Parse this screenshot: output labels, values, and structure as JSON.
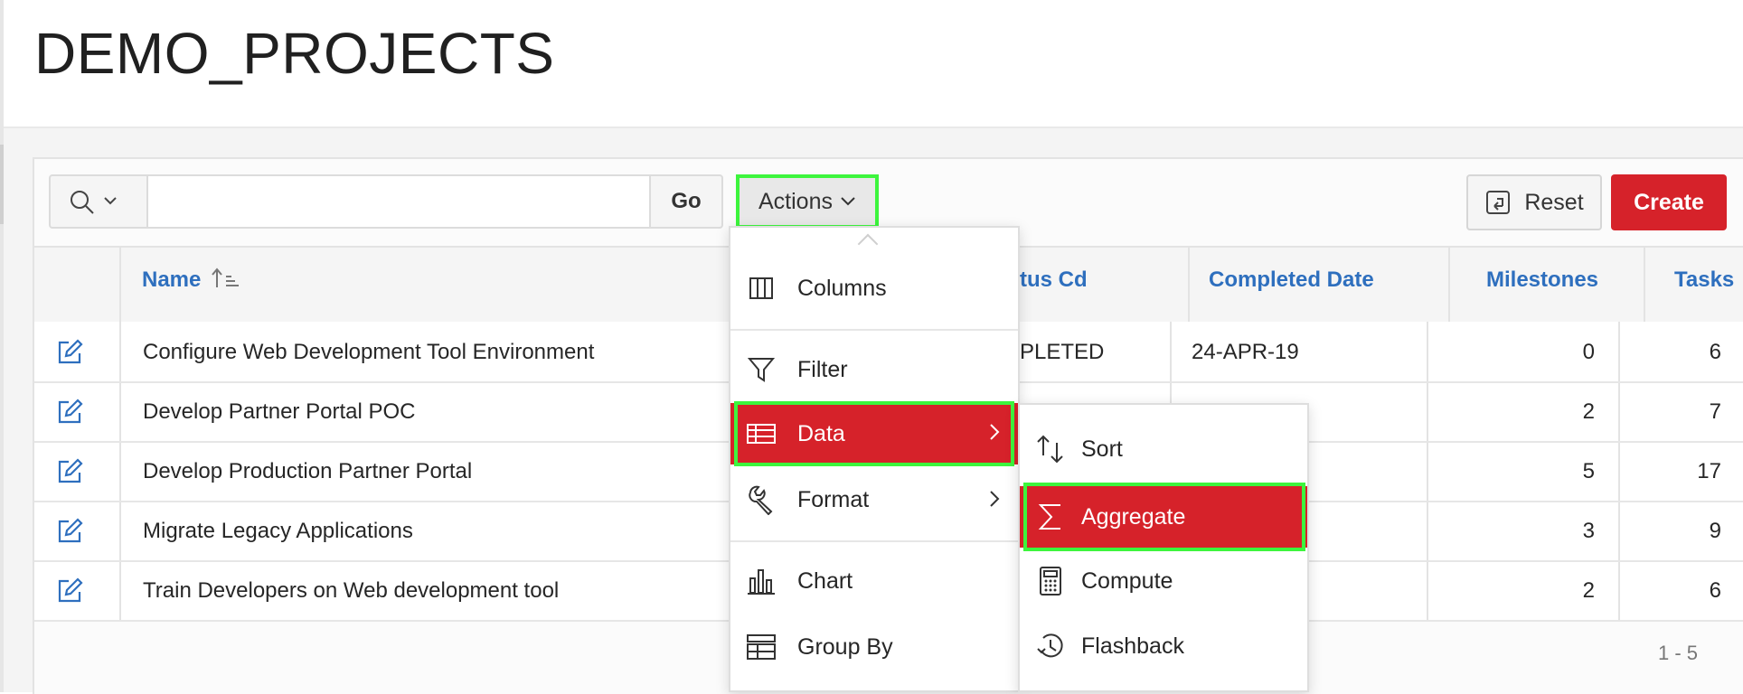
{
  "page": {
    "title": "DEMO_PROJECTS"
  },
  "toolbar": {
    "search_placeholder": "",
    "go_label": "Go",
    "actions_label": "Actions",
    "reset_label": "Reset",
    "create_label": "Create"
  },
  "table": {
    "columns": [
      {
        "label": "Name"
      },
      {
        "label": "tus Cd"
      },
      {
        "label": "Completed Date"
      },
      {
        "label": "Milestones"
      },
      {
        "label": "Tasks"
      }
    ],
    "rows": [
      {
        "name": "Configure Web Development Tool Environment",
        "status": "PLETED",
        "completed": "24-APR-19",
        "milestones": "0",
        "tasks": "6"
      },
      {
        "name": "Develop Partner Portal POC",
        "status": "",
        "completed": "",
        "milestones": "2",
        "tasks": "7"
      },
      {
        "name": "Develop Production Partner Portal",
        "status": "",
        "completed": "",
        "milestones": "5",
        "tasks": "17"
      },
      {
        "name": "Migrate Legacy Applications",
        "status": "",
        "completed": "",
        "milestones": "3",
        "tasks": "9"
      },
      {
        "name": "Train Developers on Web development tool",
        "status": "",
        "completed": "",
        "milestones": "2",
        "tasks": "6"
      }
    ],
    "pagination": "1 - 5"
  },
  "actions_menu": {
    "items": [
      {
        "label": "Columns",
        "icon": "columns-icon"
      },
      {
        "label": "Filter",
        "icon": "filter-icon"
      },
      {
        "label": "Data",
        "icon": "table-icon",
        "active": true
      },
      {
        "label": "Format",
        "icon": "wrench-icon"
      },
      {
        "label": "Chart",
        "icon": "bar-chart-icon"
      },
      {
        "label": "Group By",
        "icon": "group-by-icon"
      }
    ]
  },
  "data_submenu": {
    "items": [
      {
        "label": "Sort",
        "icon": "sort-icon"
      },
      {
        "label": "Aggregate",
        "icon": "sigma-icon",
        "active": true
      },
      {
        "label": "Compute",
        "icon": "calculator-icon"
      },
      {
        "label": "Flashback",
        "icon": "history-icon"
      }
    ]
  },
  "colors": {
    "accent_red": "#d6222a",
    "link_blue": "#2e6fbe",
    "highlight_green": "#3df53d"
  }
}
